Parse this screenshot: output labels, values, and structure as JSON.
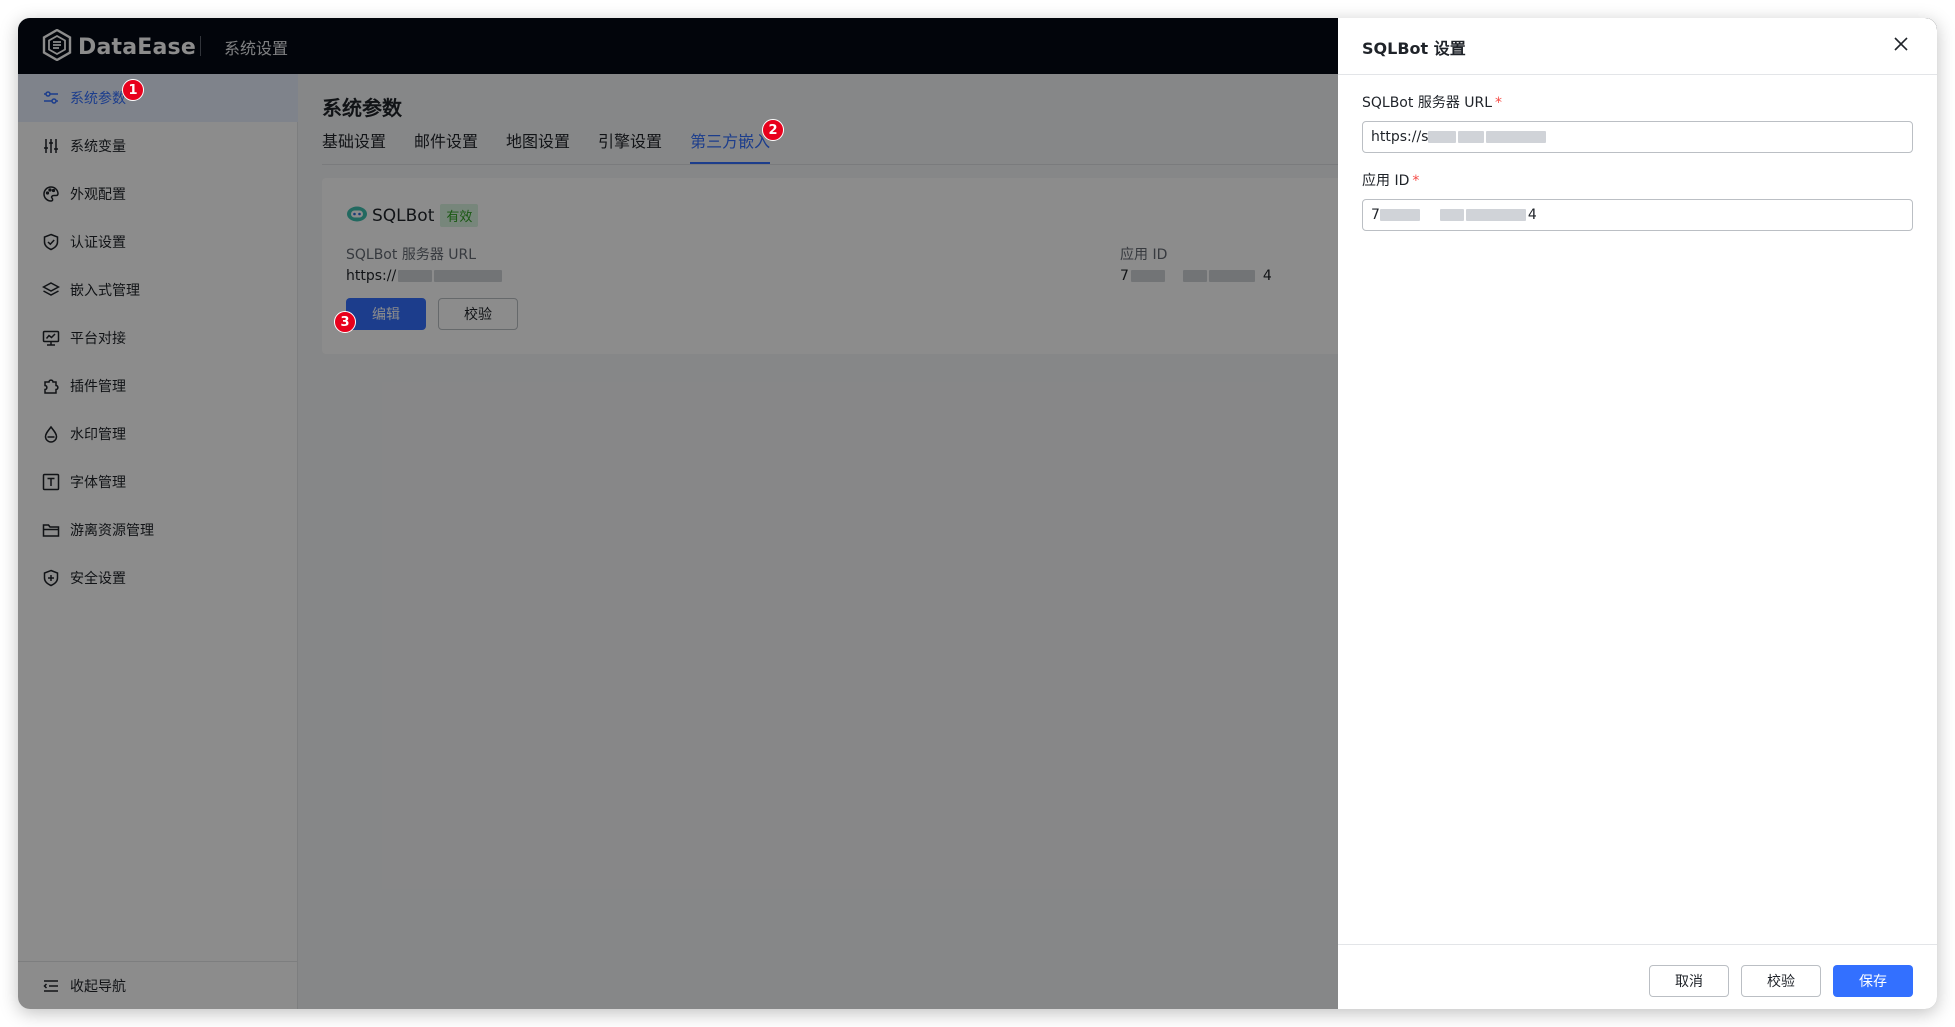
{
  "app": {
    "name": "DataEase",
    "section": "系统设置"
  },
  "sidebar": {
    "items": [
      {
        "label": "系统参数",
        "icon": "sliders-icon"
      },
      {
        "label": "系统变量",
        "icon": "variables-icon"
      },
      {
        "label": "外观配置",
        "icon": "palette-icon"
      },
      {
        "label": "认证设置",
        "icon": "shield-check-icon"
      },
      {
        "label": "嵌入式管理",
        "icon": "layers-icon"
      },
      {
        "label": "平台对接",
        "icon": "monitor-icon"
      },
      {
        "label": "插件管理",
        "icon": "puzzle-icon"
      },
      {
        "label": "水印管理",
        "icon": "drop-icon"
      },
      {
        "label": "字体管理",
        "icon": "font-icon"
      },
      {
        "label": "游离资源管理",
        "icon": "folder-icon"
      },
      {
        "label": "安全设置",
        "icon": "shield-plus-icon"
      }
    ],
    "collapse_label": "收起导航"
  },
  "main": {
    "title": "系统参数",
    "tabs": [
      "基础设置",
      "邮件设置",
      "地图设置",
      "引擎设置",
      "第三方嵌入"
    ],
    "active_tab": "第三方嵌入"
  },
  "card": {
    "name": "SQLBot",
    "status": "有效",
    "url_label": "SQLBot 服务器 URL",
    "url_value_prefix": "https://",
    "app_id_label": "应用 ID",
    "app_id_prefix": "7",
    "app_id_suffix": "4",
    "edit_label": "编辑",
    "verify_label": "校验"
  },
  "drawer": {
    "title": "SQLBot 设置",
    "url_label": "SQLBot 服务器 URL",
    "url_value_prefix": "https://s",
    "app_id_label": "应用 ID",
    "app_id_prefix": "7",
    "app_id_suffix": "4",
    "cancel_label": "取消",
    "verify_label": "校验",
    "save_label": "保存"
  },
  "steps": [
    "1",
    "2",
    "3"
  ],
  "colors": {
    "primary": "#3370ff",
    "topbar": "#050a14",
    "step_badge": "#e8001c",
    "valid_badge_bg": "#d9f4e0",
    "valid_badge_text": "#2ea121"
  }
}
